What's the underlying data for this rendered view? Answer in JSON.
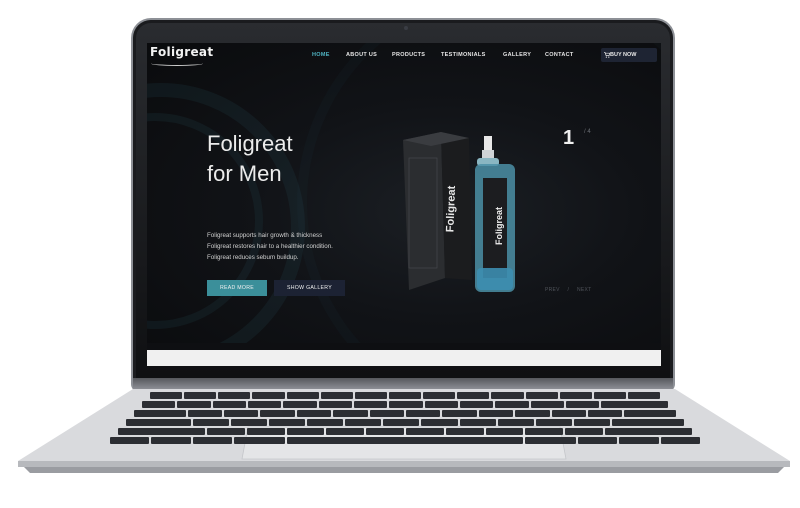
{
  "nav": {
    "logo": "Foligreat",
    "items": [
      "HOME",
      "ABOUT US",
      "PRODUCTS",
      "TESTIMONIALS",
      "GALLERY",
      "CONTACT"
    ],
    "active_item": "HOME",
    "buy_label": "BUY NOW",
    "buy_icon": "cart-icon"
  },
  "hero": {
    "title_line1": "Foligreat",
    "title_line2": "for Men",
    "text_lines": [
      "Foligreat supports hair growth & thickness",
      "Foligreat restores hair to a healthier condition.",
      "Foligreat reduces sebum buildup."
    ],
    "read_more": "READ MORE",
    "show_gallery": "SHOW GALLERY"
  },
  "product": {
    "box_label": "Foligreat",
    "bottle_label": "Foligreat"
  },
  "slider": {
    "current": "1",
    "total": "/ 4",
    "prev": "PREV",
    "separator": "/",
    "next": "NEXT"
  },
  "colors": {
    "accent": "#4fb3c2",
    "button_primary": "#3b8f9a",
    "button_secondary": "#1c2233",
    "background": "#111317"
  }
}
